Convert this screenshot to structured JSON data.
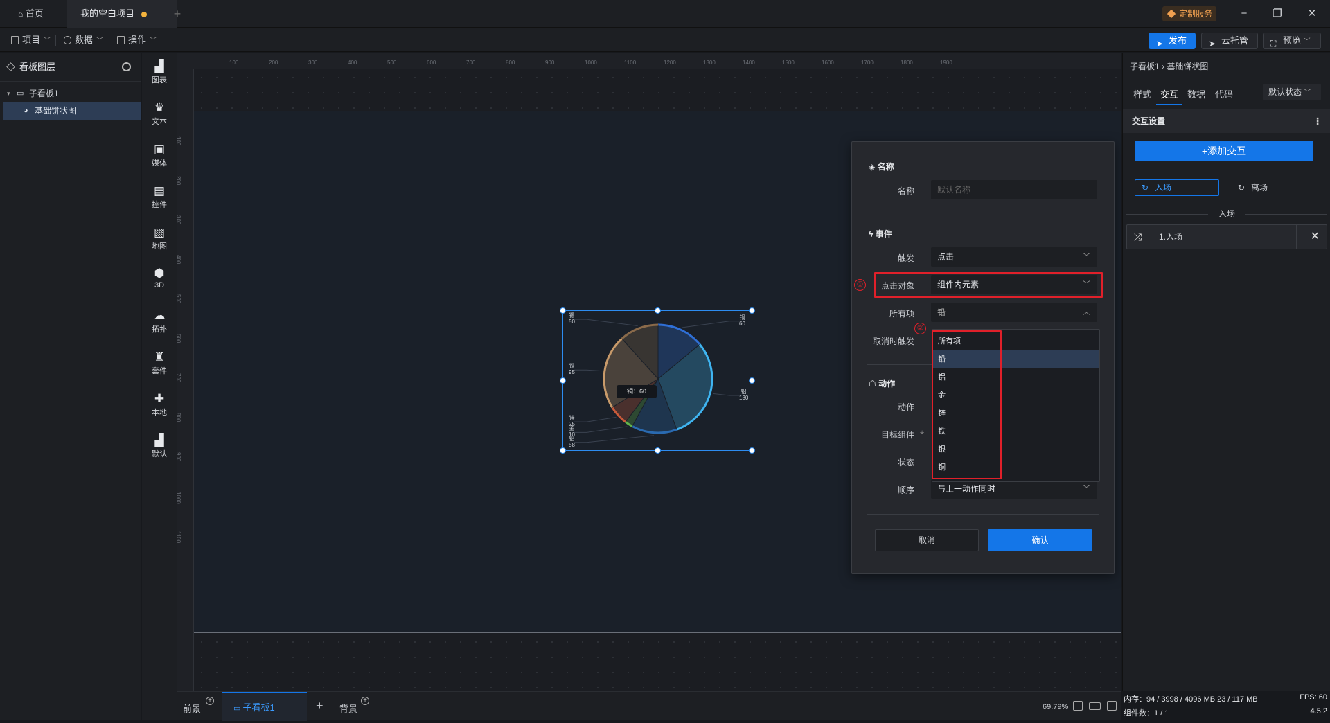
{
  "titlebar": {
    "home_tab": "首页",
    "project_tab": "我的空白项目",
    "add_tab": "+",
    "custom_service": "定制服务"
  },
  "menubar": {
    "project": "项目",
    "data": "数据",
    "operation": "操作",
    "publish": "发布",
    "cloud_host": "云托管",
    "preview": "预览"
  },
  "layers": {
    "title": "看板图层",
    "items": [
      {
        "label": "子看板1"
      },
      {
        "label": "基础饼状图"
      }
    ]
  },
  "components": [
    "图表",
    "文本",
    "媒体",
    "控件",
    "地图",
    "3D",
    "拓扑",
    "套件",
    "本地",
    "默认"
  ],
  "rulers": {
    "top": [
      "100",
      "200",
      "300",
      "400",
      "500",
      "600",
      "700",
      "800",
      "900",
      "1000",
      "1100",
      "1200",
      "1300",
      "1400",
      "1500",
      "1600",
      "1700",
      "1800",
      "1900"
    ],
    "left": [
      "100",
      "200",
      "300",
      "400",
      "500",
      "600",
      "700",
      "800",
      "900",
      "1000",
      "1100"
    ]
  },
  "chart_data": {
    "type": "pie",
    "categories": [
      "铜",
      "铝",
      "铅",
      "金",
      "锌",
      "铁",
      "锡"
    ],
    "values": [
      60,
      130,
      58,
      10,
      25,
      95,
      50
    ],
    "colors": [
      "#2f6fd6",
      "#3fb4f0",
      "#2a6ab0",
      "#62b44a",
      "#c85a3a",
      "#c89a6a",
      "#8a6a4a"
    ],
    "tooltip": "铜：60"
  },
  "dialog": {
    "name_section": "名称",
    "name_label": "名称",
    "name_placeholder": "默认名称",
    "event_section": "事件",
    "trigger_label": "触发",
    "trigger_value": "点击",
    "click_target_label": "点击对象",
    "click_target_value": "组件内元素",
    "all_items_label": "所有项",
    "all_items_value": "铅",
    "cancel_trigger_label": "取消时触发",
    "action_section": "动作",
    "action_label": "动作",
    "target_label": "目标组件",
    "state_label": "状态",
    "order_label": "顺序",
    "order_value": "与上一动作同时",
    "cancel": "取消",
    "confirm": "确认",
    "marker1": "①",
    "marker2": "②"
  },
  "dropdown": {
    "options": [
      "所有项",
      "铅",
      "铝",
      "金",
      "锌",
      "铁",
      "银",
      "铜"
    ],
    "selected_index": 1
  },
  "right_panel": {
    "breadcrumb": "子看板1 › 基础饼状图",
    "tabs": [
      "样式",
      "交互",
      "数据",
      "代码"
    ],
    "active_tab": "交互",
    "state_select": "默认状态",
    "section_title": "交互设置",
    "add_button": "+添加交互",
    "enter_tab": "入场",
    "leave_tab": "离场",
    "divider_label": "入场",
    "action_item": "1.入场"
  },
  "bottombar": {
    "foreground": "前景",
    "sub_board": "子看板1",
    "background": "背景",
    "zoom": "69.79%"
  },
  "status": {
    "memory": "内存：94 / 3998 / 4096 MB  23 / 117 MB",
    "fps": "FPS: 60",
    "component_count": "组件数：1 / 1",
    "version": "4.5.2"
  }
}
